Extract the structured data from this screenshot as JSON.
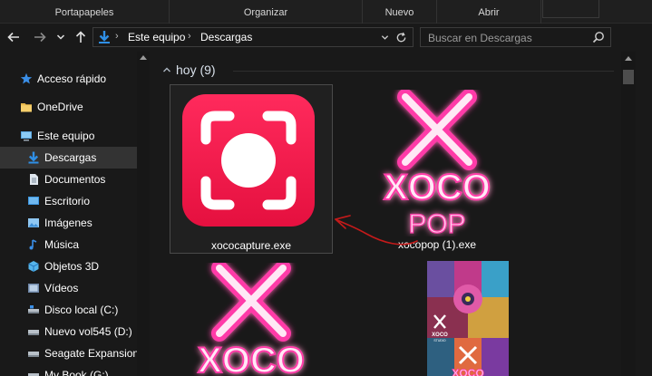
{
  "ribbon": {
    "groups": [
      "Portapapeles",
      "Organizar",
      "Nuevo",
      "Abrir"
    ]
  },
  "nav": {
    "back_icon": "arrow-left-icon",
    "forward_icon": "arrow-right-icon",
    "recent_icon": "chevron-down-icon",
    "up_icon": "arrow-up-icon"
  },
  "address": {
    "crumbs": [
      "Este equipo",
      "Descargas"
    ],
    "separator": "›"
  },
  "search": {
    "placeholder": "Buscar en Descargas",
    "value": ""
  },
  "sidebar": {
    "items": [
      {
        "label": "Acceso rápido",
        "icon": "star-icon",
        "selected": false
      },
      {
        "label": "OneDrive",
        "icon": "folder-icon",
        "selected": false
      },
      {
        "label": "Este equipo",
        "icon": "computer-icon",
        "selected": false
      },
      {
        "label": "Descargas",
        "icon": "download-icon",
        "selected": true
      },
      {
        "label": "Documentos",
        "icon": "documents-icon",
        "selected": false
      },
      {
        "label": "Escritorio",
        "icon": "desktop-icon",
        "selected": false
      },
      {
        "label": "Imágenes",
        "icon": "pictures-icon",
        "selected": false
      },
      {
        "label": "Música",
        "icon": "music-icon",
        "selected": false
      },
      {
        "label": "Objetos 3D",
        "icon": "cube-icon",
        "selected": false
      },
      {
        "label": "Vídeos",
        "icon": "videos-icon",
        "selected": false
      },
      {
        "label": "Disco local (C:)",
        "icon": "drive-icon",
        "selected": false
      },
      {
        "label": "Nuevo vol545 (D:)",
        "icon": "drive-icon",
        "selected": false
      },
      {
        "label": "Seagate Expansion D",
        "icon": "drive-icon",
        "selected": false
      },
      {
        "label": "My Book (G:)",
        "icon": "drive-icon",
        "selected": false
      }
    ]
  },
  "content": {
    "group_title": "hoy (9)",
    "files": [
      {
        "name": "xococapture.exe",
        "icon": "xococapture-app-icon",
        "selected": true
      },
      {
        "name": "xocopop (1).exe",
        "icon": "xocopop-app-icon",
        "selected": false
      },
      {
        "name": "",
        "icon": "xoco-app-icon",
        "selected": false
      },
      {
        "name": "",
        "icon": "xoco-studio-image-icon",
        "selected": false
      }
    ],
    "logo_text": {
      "xoco": "XOCO",
      "pop": "POP",
      "studio": "STUDIO"
    }
  },
  "colors": {
    "background": "#191919",
    "capture_red": "#f0174a",
    "neon_pink": "#ff3ba8",
    "annotation_red": "#c41a1a",
    "selected_row": "#333333"
  }
}
